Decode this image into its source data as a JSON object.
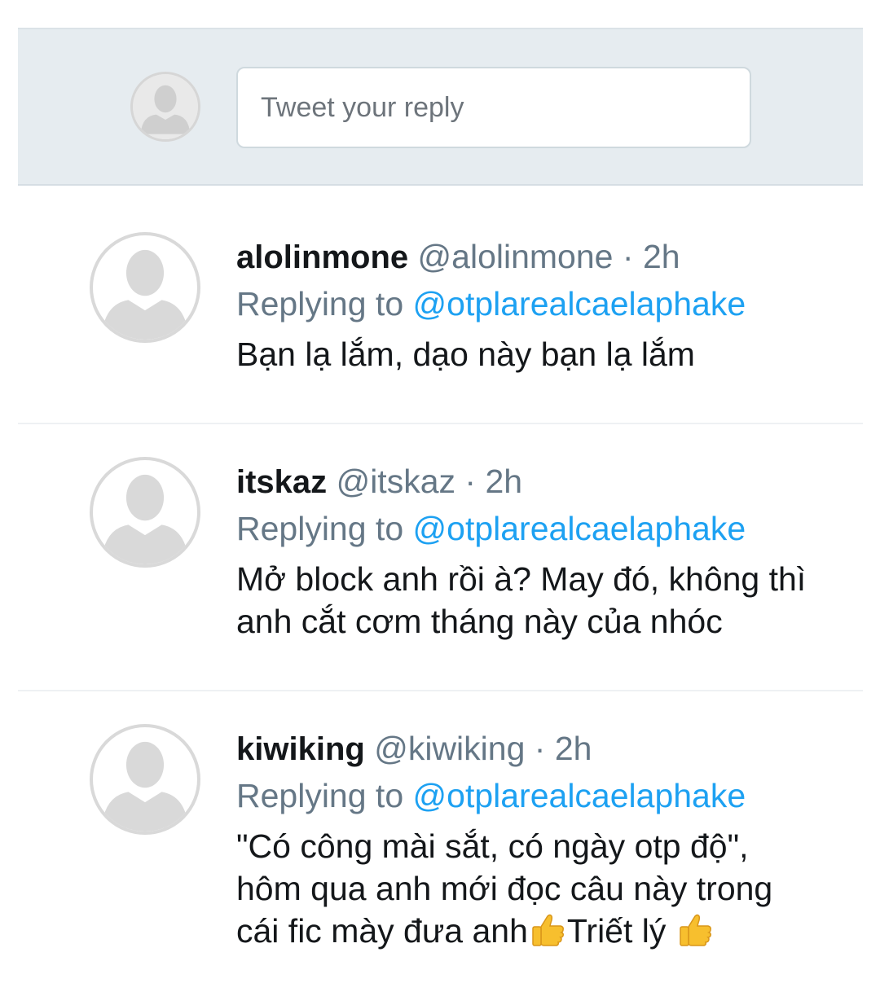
{
  "compose": {
    "placeholder": "Tweet your reply"
  },
  "tweets": [
    {
      "name": "alolinmone",
      "handle": "@alolinmone",
      "time": "2h",
      "replying_prefix": "Replying to",
      "replying_to": "@otplarealcaelaphake",
      "lines": [
        "Bạn lạ lắm, dạo này bạn lạ lắm"
      ]
    },
    {
      "name": "itskaz",
      "handle": "@itskaz",
      "time": "2h",
      "replying_prefix": "Replying to",
      "replying_to": "@otplarealcaelaphake",
      "lines": [
        "Mở block anh rồi à? May đó, không thì",
        "anh cắt cơm tháng này của nhóc"
      ]
    },
    {
      "name": "kiwiking",
      "handle": "@kiwiking",
      "time": "2h",
      "replying_prefix": "Replying to",
      "replying_to": "@otplarealcaelaphake",
      "lines": [
        "\"Có công mài sắt, có ngày otp độ\",",
        "hôm qua anh mới đọc câu này trong",
        "cái fic mày đưa anh",
        "Triết lý"
      ]
    }
  ],
  "icons": {
    "avatar": "default-profile-icon",
    "emoji": "thumbs-up-icon"
  },
  "colors": {
    "link": "#1da1f2",
    "secondary_text": "#657786",
    "primary_text": "#14171a",
    "compose_bg": "#e6ecf0"
  }
}
